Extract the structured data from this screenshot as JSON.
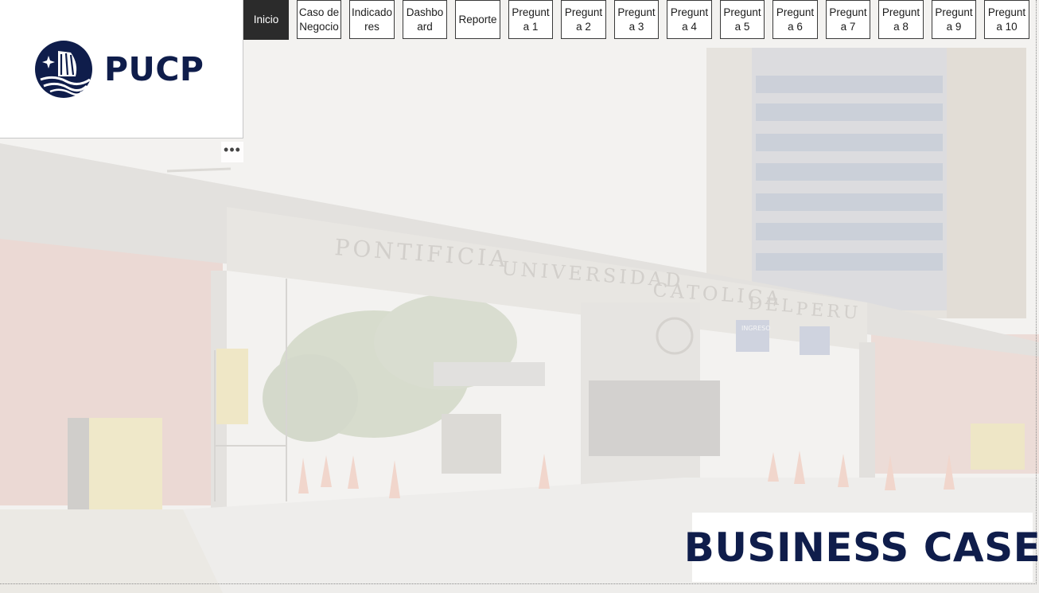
{
  "colors": {
    "brand_navy": "#0f1d4b",
    "nav_active_bg": "#2b2b2b",
    "nav_border": "#3a3a3a"
  },
  "logo": {
    "text": "PUCP",
    "icon": "pucp-ship-shield-icon"
  },
  "background": {
    "sign_words": [
      "PONTIFICIA",
      "UNIVERSIDAD",
      "CATOLICA",
      "DEL",
      "PERU"
    ],
    "sign_ingreso": "INGRESO"
  },
  "more_options": {
    "label": "•••",
    "icon": "ellipsis-icon"
  },
  "nav": {
    "active_index": 0,
    "items": [
      {
        "label": "Inicio"
      },
      {
        "label": "Caso de Negocio"
      },
      {
        "label": "Indicadores"
      },
      {
        "label": "Dashboard"
      },
      {
        "label": "Reporte"
      },
      {
        "label": "Pregunta 1"
      },
      {
        "label": "Pregunta 2"
      },
      {
        "label": "Pregunta 3"
      },
      {
        "label": "Pregunta 4"
      },
      {
        "label": "Pregunta 5"
      },
      {
        "label": "Pregunta 6"
      },
      {
        "label": "Pregunta 7"
      },
      {
        "label": "Pregunta 8"
      },
      {
        "label": "Pregunta 9"
      },
      {
        "label": "Pregunta 10"
      }
    ]
  },
  "title": {
    "text": "BUSINESS CASE"
  }
}
